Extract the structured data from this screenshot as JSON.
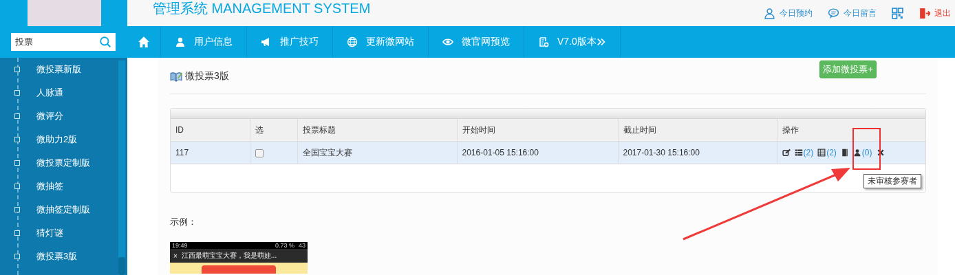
{
  "header": {
    "title": "管理系统 MANAGEMENT SYSTEM",
    "links": [
      {
        "kind": "user",
        "label": "今日预约"
      },
      {
        "kind": "chat",
        "label": "今日留言"
      },
      {
        "kind": "qr"
      },
      {
        "kind": "logout",
        "label": "退出"
      }
    ]
  },
  "sidebar": {
    "search": {
      "value": "投票"
    },
    "items": [
      "微投票新版",
      "人脉通",
      "微评分",
      "微助力2版",
      "微投票定制版",
      "微抽签",
      "微抽签定制版",
      "猜灯谜",
      "微投票3版"
    ]
  },
  "nav": [
    {
      "kind": "home"
    },
    {
      "kind": "user",
      "label": "用户信息"
    },
    {
      "kind": "megaphone",
      "label": "推广技巧"
    },
    {
      "kind": "globe",
      "label": "更新微网站"
    },
    {
      "kind": "eye",
      "label": "微官网预览"
    },
    {
      "kind": "doc",
      "label": "V7.0版本"
    }
  ],
  "page": {
    "title": "微投票3版",
    "add_button": "添加微投票+"
  },
  "table": {
    "columns": [
      "ID",
      "选",
      "投票标题",
      "开始时间",
      "截止时间",
      "操作"
    ],
    "rows": [
      {
        "id": "117",
        "checked": false,
        "title": "全国宝宝大赛",
        "start": "2016-01-05 15:16:00",
        "end": "2017-01-30 15:16:00",
        "actions": [
          {
            "kind": "edit"
          },
          {
            "kind": "list",
            "count": "(2)"
          },
          {
            "kind": "table",
            "count": "(2)"
          },
          {
            "kind": "book"
          },
          {
            "kind": "user",
            "count": "(0)"
          },
          {
            "kind": "delete"
          }
        ]
      }
    ]
  },
  "tooltip": "未审核参赛者",
  "example": {
    "label": "示例：",
    "preview": {
      "time": "19:49",
      "status": "0.73 %",
      "battery": "43",
      "close": "×",
      "title": "江西最萌宝宝大赛，我是萌娃..."
    }
  }
}
